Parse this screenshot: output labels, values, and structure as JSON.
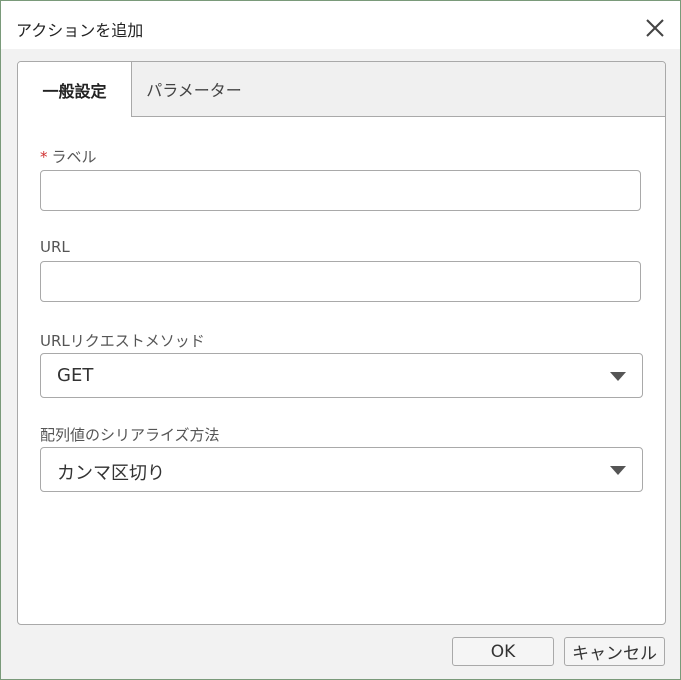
{
  "dialog": {
    "title": "アクションを追加",
    "close_icon": "close-icon"
  },
  "tabs": [
    {
      "label": "一般設定",
      "active": true
    },
    {
      "label": "パラメーター",
      "active": false
    }
  ],
  "form": {
    "label_field": {
      "required_mark": "*",
      "label": "ラベル",
      "value": ""
    },
    "url_field": {
      "label": "URL",
      "value": ""
    },
    "method_field": {
      "label": "URLリクエストメソッド",
      "value": "GET",
      "icon": "chevron-down-icon"
    },
    "serialize_field": {
      "label": "配列値のシリアライズ方法",
      "value": "カンマ区切り",
      "icon": "chevron-down-icon"
    }
  },
  "footer": {
    "ok_label": "OK",
    "cancel_label": "キャンセル"
  },
  "colors": {
    "required": "#d03030",
    "border": "#a9a9a9",
    "tabbar_bg": "#f0f0f0",
    "window_border": "#7a9a7a"
  }
}
